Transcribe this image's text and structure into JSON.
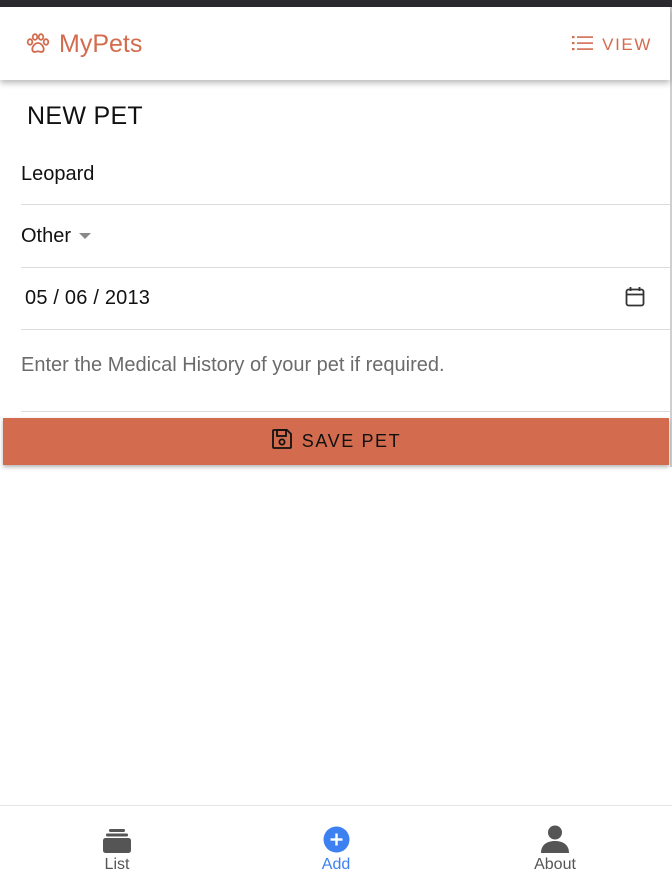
{
  "app": {
    "title": "MyPets",
    "view_label": "VIEW"
  },
  "page": {
    "title": "NEW PET"
  },
  "form": {
    "name_value": "Leopard",
    "type_value": "Other",
    "date_value": "05 / 06 / 2013",
    "notes_placeholder": "Enter the Medical History of your pet if required.",
    "save_label": "SAVE PET"
  },
  "tabs": [
    {
      "label": "List",
      "icon": "stack-icon"
    },
    {
      "label": "Add",
      "icon": "add-circle-icon",
      "active": true
    },
    {
      "label": "About",
      "icon": "person-icon"
    }
  ],
  "colors": {
    "brand": "#d36c4f",
    "active_tab": "#3d80f2",
    "inactive_tab": "#555555"
  }
}
